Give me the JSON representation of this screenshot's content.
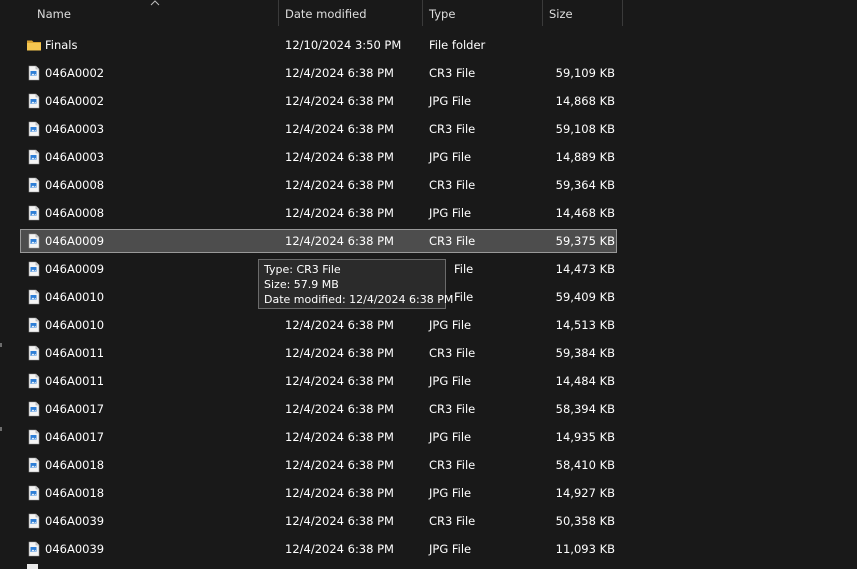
{
  "columns": {
    "name": "Name",
    "date": "Date modified",
    "type": "Type",
    "size": "Size"
  },
  "rows": [
    {
      "icon": "folder-icon",
      "name": "Finals",
      "date": "12/10/2024 3:50 PM",
      "type": "File folder",
      "size": ""
    },
    {
      "icon": "file-icon",
      "name": "046A0002",
      "date": "12/4/2024 6:38 PM",
      "type": "CR3 File",
      "size": "59,109 KB"
    },
    {
      "icon": "file-icon",
      "name": "046A0002",
      "date": "12/4/2024 6:38 PM",
      "type": "JPG File",
      "size": "14,868 KB"
    },
    {
      "icon": "file-icon",
      "name": "046A0003",
      "date": "12/4/2024 6:38 PM",
      "type": "CR3 File",
      "size": "59,108 KB"
    },
    {
      "icon": "file-icon",
      "name": "046A0003",
      "date": "12/4/2024 6:38 PM",
      "type": "JPG File",
      "size": "14,889 KB"
    },
    {
      "icon": "file-icon",
      "name": "046A0008",
      "date": "12/4/2024 6:38 PM",
      "type": "CR3 File",
      "size": "59,364 KB"
    },
    {
      "icon": "file-icon",
      "name": "046A0008",
      "date": "12/4/2024 6:38 PM",
      "type": "JPG File",
      "size": "14,468 KB"
    },
    {
      "icon": "file-icon",
      "name": "046A0009",
      "date": "12/4/2024 6:38 PM",
      "type": "CR3 File",
      "size": "59,375 KB",
      "selected": true
    },
    {
      "icon": "file-icon",
      "name": "046A0009",
      "date": "",
      "type": "File",
      "size": "14,473 KB"
    },
    {
      "icon": "file-icon",
      "name": "046A0010",
      "date": "",
      "type": "File",
      "size": "59,409 KB"
    },
    {
      "icon": "file-icon",
      "name": "046A0010",
      "date": "12/4/2024 6:38 PM",
      "type": "JPG File",
      "size": "14,513 KB"
    },
    {
      "icon": "file-icon",
      "name": "046A0011",
      "date": "12/4/2024 6:38 PM",
      "type": "CR3 File",
      "size": "59,384 KB"
    },
    {
      "icon": "file-icon",
      "name": "046A0011",
      "date": "12/4/2024 6:38 PM",
      "type": "JPG File",
      "size": "14,484 KB"
    },
    {
      "icon": "file-icon",
      "name": "046A0017",
      "date": "12/4/2024 6:38 PM",
      "type": "CR3 File",
      "size": "58,394 KB"
    },
    {
      "icon": "file-icon",
      "name": "046A0017",
      "date": "12/4/2024 6:38 PM",
      "type": "JPG File",
      "size": "14,935 KB"
    },
    {
      "icon": "file-icon",
      "name": "046A0018",
      "date": "12/4/2024 6:38 PM",
      "type": "CR3 File",
      "size": "58,410 KB"
    },
    {
      "icon": "file-icon",
      "name": "046A0018",
      "date": "12/4/2024 6:38 PM",
      "type": "JPG File",
      "size": "14,927 KB"
    },
    {
      "icon": "file-icon",
      "name": "046A0039",
      "date": "12/4/2024 6:38 PM",
      "type": "CR3 File",
      "size": "50,358 KB"
    },
    {
      "icon": "file-icon",
      "name": "046A0039",
      "date": "12/4/2024 6:38 PM",
      "type": "JPG File",
      "size": "11,093 KB"
    }
  ],
  "tooltip": {
    "type_line": "Type: CR3 File",
    "size_line": "Size: 57.9 MB",
    "date_line": "Date modified: 12/4/2024 6:38 PM"
  },
  "colors": {
    "background": "#191919",
    "selection": "#4d4d4d",
    "folder": "#f0c14b",
    "file_icon_accent": "#2f7fd6"
  }
}
